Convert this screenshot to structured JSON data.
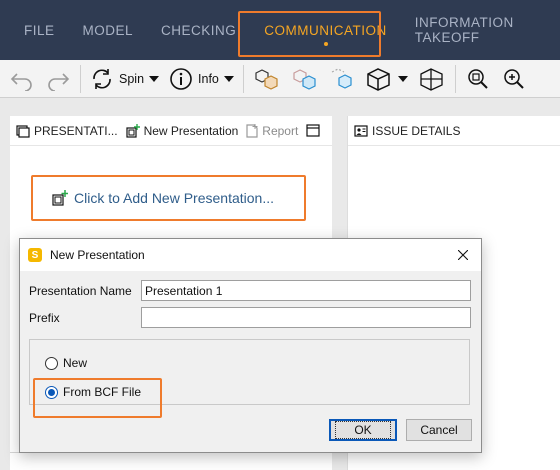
{
  "menu": {
    "items": [
      {
        "label": "FILE"
      },
      {
        "label": "MODEL"
      },
      {
        "label": "CHECKING"
      },
      {
        "label": "COMMUNICATION"
      },
      {
        "label": "INFORMATION TAKEOFF"
      }
    ],
    "active_index": 3
  },
  "toolbar": {
    "spin_label": "Spin",
    "info_label": "Info"
  },
  "left_panel": {
    "title": "PRESENTATI...",
    "new_presentation_label": "New Presentation",
    "report_label": "Report",
    "add_presentation_label": "Click to Add New Presentation..."
  },
  "right_panel": {
    "title": "ISSUE DETAILS"
  },
  "dialog": {
    "title": "New Presentation",
    "app_icon_letter": "S",
    "name_label": "Presentation Name",
    "name_value": "Presentation 1",
    "prefix_label": "Prefix",
    "prefix_value": "",
    "options": [
      {
        "label": "New",
        "checked": false
      },
      {
        "label": "From BCF File",
        "checked": true
      }
    ],
    "ok_label": "OK",
    "cancel_label": "Cancel"
  },
  "colors": {
    "menubar_bg": "#2f3b52",
    "menu_active": "#f5a623",
    "highlight_box": "#ef7b2c",
    "link_text": "#2f5d8a",
    "radio_checked": "#0a58b8"
  },
  "icons": [
    "undo-icon",
    "redo-icon",
    "spin-icon",
    "info-icon",
    "cubes-icon",
    "box-icon",
    "zoom-fit-icon",
    "zoom-in-icon"
  ]
}
